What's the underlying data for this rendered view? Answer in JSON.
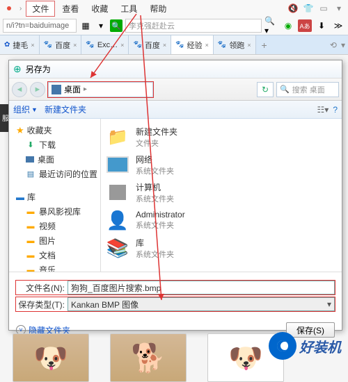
{
  "browser": {
    "menu": [
      "文件",
      "查看",
      "收藏",
      "工具",
      "帮助"
    ],
    "url_fragment": "n/i?tn=baiduimage",
    "search_placeholder": "李克强赶赴云",
    "tabs": [
      {
        "label": "捷毛"
      },
      {
        "label": "百度"
      },
      {
        "label": "Exc…"
      },
      {
        "label": "百度"
      },
      {
        "label": "经验"
      },
      {
        "label": "领跑"
      }
    ]
  },
  "dialog": {
    "title": "另存为",
    "nav_location": "桌面",
    "search_placeholder": "搜索 桌面",
    "toolbar": {
      "organize": "组织",
      "newfolder": "新建文件夹"
    },
    "sidebar": {
      "fav_header": "收藏夹",
      "fav_items": [
        "下载",
        "桌面",
        "最近访问的位置"
      ],
      "lib_header": "库",
      "lib_items": [
        "暴风影视库",
        "视频",
        "图片",
        "文档",
        "音乐"
      ]
    },
    "files": [
      {
        "title": "新建文件夹",
        "sub": "文件夹",
        "thumb": "folder"
      },
      {
        "title": "网络",
        "sub": "系统文件夹",
        "thumb": "monitor"
      },
      {
        "title": "计算机",
        "sub": "系统文件夹",
        "thumb": "pc"
      },
      {
        "title": "Administrator",
        "sub": "系统文件夹",
        "thumb": "user"
      },
      {
        "title": "库",
        "sub": "系统文件夹",
        "thumb": "lib"
      }
    ],
    "filename_label": "文件名(N):",
    "filename_value": "狗狗_百度图片搜索.bmp",
    "filetype_label": "保存类型(T):",
    "filetype_value": "Kankan BMP 图像",
    "hide_folders": "隐藏文件夹",
    "save_btn": "保存(S)"
  },
  "left_strip": "服",
  "watermark": "好装机"
}
